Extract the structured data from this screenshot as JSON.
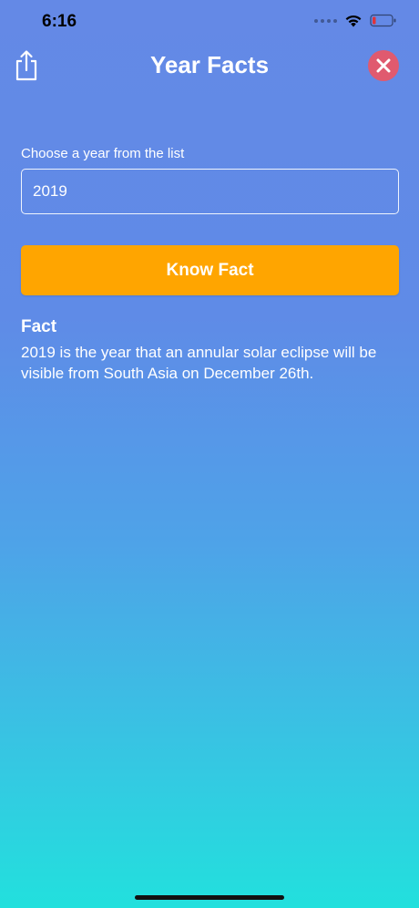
{
  "status_bar": {
    "time": "6:16",
    "icons": [
      "signal-dots-icon",
      "wifi-icon",
      "battery-low-icon"
    ],
    "battery_color": "#e0343a"
  },
  "header": {
    "title": "Year Facts",
    "share_icon": "share-icon",
    "close_icon": "close-icon",
    "close_color": "#e05a6f"
  },
  "form": {
    "label": "Choose a year from the list",
    "year_value": "2019",
    "button_label": "Know Fact",
    "button_color": "#ffa500"
  },
  "fact": {
    "heading": "Fact",
    "text": "2019 is the year that an annular solar eclipse will be visible from South Asia on December 26th."
  },
  "theme": {
    "gradient_top": "#6489e6",
    "gradient_bottom": "#22e0dd"
  }
}
